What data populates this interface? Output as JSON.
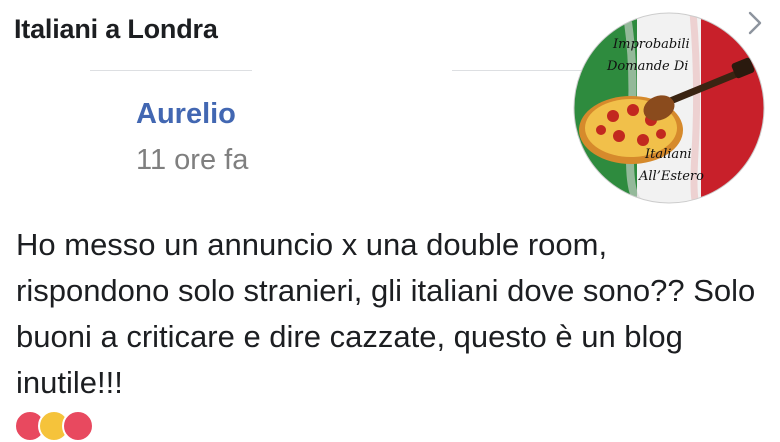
{
  "header": {
    "group_name": "Italiani a Londra",
    "chevron_icon": "chevron-right-icon"
  },
  "post": {
    "author": "Aurelio",
    "time": "11 ore fa",
    "text": "Ho messo un annuncio x una double room, rispondono solo stranieri, gli italiani dove sono?? Solo buoni a criticare e dire cazzate, questo è un blog inutile!!!"
  },
  "badge": {
    "line1": "Improbabili",
    "line2": "Domande Di",
    "line3": "Italiani",
    "line4": "All’Estero",
    "colors": {
      "green": "#2e8b3e",
      "white": "#f2f2f2",
      "red": "#c8202a"
    }
  },
  "reactions": [
    {
      "icon": "love-reaction-icon",
      "color": "#e8495f"
    },
    {
      "icon": "haha-reaction-icon",
      "color": "#f5c33b"
    },
    {
      "icon": "angry-reaction-icon",
      "color": "#e8495f"
    }
  ]
}
